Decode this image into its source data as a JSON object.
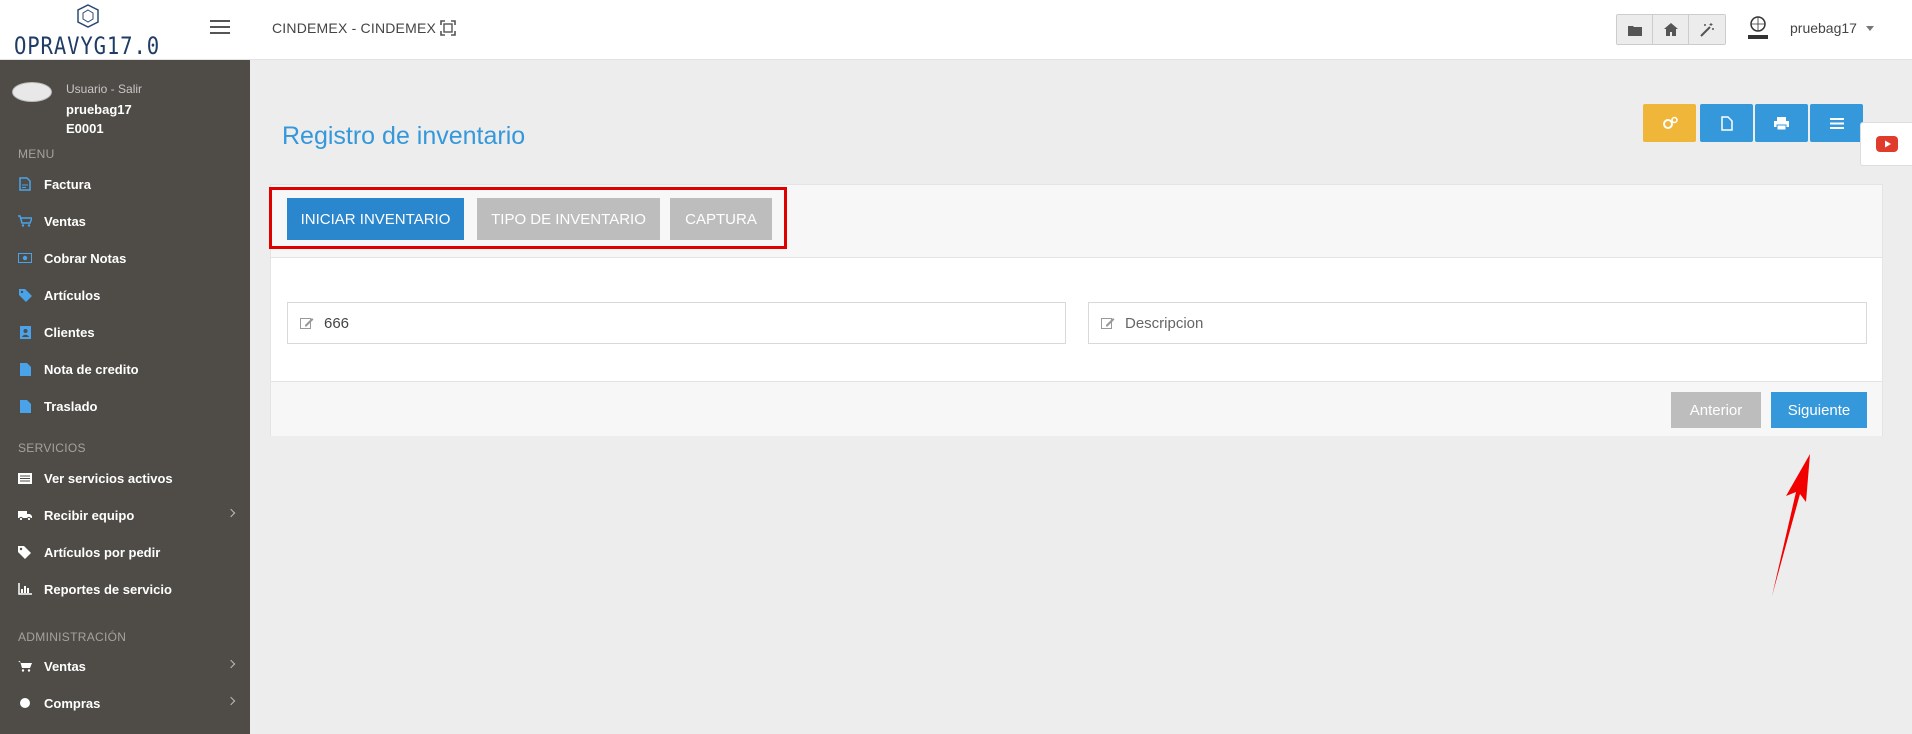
{
  "header": {
    "company": "CINDEMEX - CINDEMEX",
    "user": "pruebag17",
    "logo_text": "OPRAVYG17.0",
    "quick_buttons": [
      "folder-icon",
      "home-icon",
      "magic-wand-icon"
    ]
  },
  "sidebar": {
    "profile": {
      "top_text": "Usuario - Salir",
      "username": "pruebag17",
      "code": "E0001"
    },
    "sections": {
      "menu": "MENU",
      "servicios": "SERVICIOS",
      "administracion": "ADMINISTRACIÓN"
    },
    "menu_items": [
      "Factura",
      "Ventas",
      "Cobrar Notas",
      "Artículos",
      "Clientes",
      "Nota de credito",
      "Traslado"
    ],
    "servicios_items": [
      "Ver servicios activos",
      "Recibir equipo",
      "Artículos por pedir",
      "Reportes de servicio"
    ],
    "admin_items": [
      "Ventas",
      "Compras"
    ]
  },
  "main": {
    "title": "Registro de inventario",
    "toolbar": [
      "cogs-icon",
      "file-icon",
      "print-icon",
      "list-icon"
    ],
    "tabs": [
      "INICIAR INVENTARIO",
      "TIPO DE INVENTARIO",
      "CAPTURA"
    ],
    "active_tab": "INICIAR INVENTARIO",
    "fields": {
      "code_value": "666",
      "description_placeholder": "Descripcion"
    },
    "buttons": {
      "prev": "Anterior",
      "next": "Siguiente"
    }
  },
  "colors": {
    "primary": "#3498db",
    "tab_active": "#2a86cd",
    "tab_inactive": "#bdbdbd",
    "warning": "#f0b63a",
    "sidebar": "#4f4c48",
    "annotation": "#e00000"
  }
}
